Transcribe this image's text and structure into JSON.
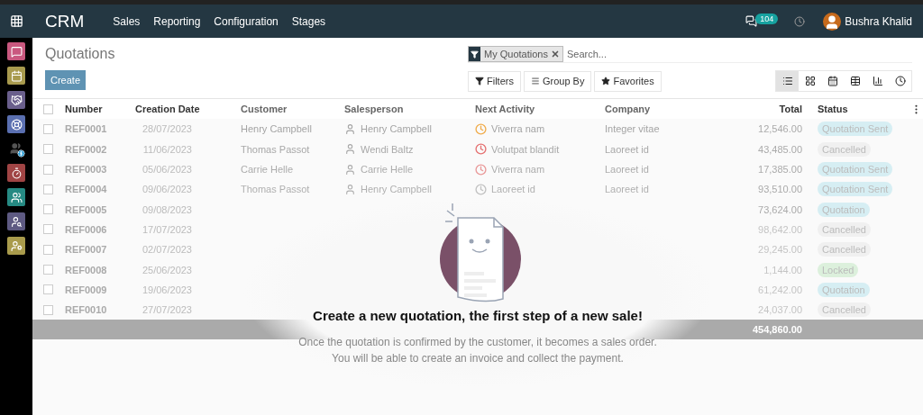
{
  "navbar": {
    "app_name": "CRM",
    "menus": [
      "Sales",
      "Reporting",
      "Configuration",
      "Stages"
    ],
    "message_count": "104",
    "user_name": "Bushra Khalid"
  },
  "sidebar": {
    "items": [
      {
        "kind": "chat",
        "color": "#c9587f"
      },
      {
        "kind": "calendar",
        "color": "#a89a4e"
      },
      {
        "kind": "handshake",
        "color": "#6a5f8c"
      },
      {
        "kind": "lifebuoy",
        "color": "#5a6fb0"
      },
      {
        "kind": "payroll",
        "color": "#000000"
      },
      {
        "kind": "timer",
        "color": "#a04444"
      },
      {
        "kind": "team",
        "color": "#268a83"
      },
      {
        "kind": "search",
        "color": "#5e5a82"
      },
      {
        "kind": "settings",
        "color": "#a99b4c"
      }
    ]
  },
  "control_panel": {
    "title": "Quotations",
    "create_button": "Create",
    "facet": "My Quotations",
    "search_placeholder": "Search...",
    "buttons": [
      "Filters",
      "Group By",
      "Favorites"
    ],
    "views": [
      {
        "kind": "list",
        "selected": true
      },
      {
        "kind": "kanban",
        "selected": false
      },
      {
        "kind": "calendar",
        "selected": false
      },
      {
        "kind": "pivot",
        "selected": false
      },
      {
        "kind": "graph",
        "selected": false
      },
      {
        "kind": "activity",
        "selected": false
      }
    ]
  },
  "table": {
    "select_all": {
      "checked": false
    },
    "columns": [
      "Number",
      "Creation Date",
      "Customer",
      "Salesperson",
      "Next Activity",
      "Company",
      "Total",
      "Status"
    ],
    "rows": [
      {
        "checked": false,
        "number": "REF0001",
        "date": "28/07/2023",
        "customer": "Henry Campbell",
        "salesperson": "Henry Campbell",
        "activity": {
          "text": "Viverra nam",
          "color": "#f0ad4e"
        },
        "company": "Integer vitae",
        "total": "12,546.00",
        "status": {
          "text": "Quotation Sent",
          "color": "#d6eef3"
        }
      },
      {
        "checked": false,
        "number": "REF0002",
        "date": "11/06/2023",
        "customer": "Thomas Passot",
        "salesperson": "Wendi Baltz",
        "activity": {
          "text": "Volutpat blandit",
          "color": "#e57373"
        },
        "company": "Laoreet id",
        "total": "43,485.00",
        "status": {
          "text": "Cancelled",
          "color": "#f0f0f0"
        }
      },
      {
        "checked": false,
        "number": "REF0003",
        "date": "05/06/2023",
        "customer": "Carrie Helle",
        "salesperson": "Carrie Helle",
        "activity": {
          "text": "Viverra nam",
          "color": "#e99a9a"
        },
        "company": "Laoreet id",
        "total": "17,385.00",
        "status": {
          "text": "Quotation Sent",
          "color": "#d6eef3"
        }
      },
      {
        "checked": false,
        "number": "REF0004",
        "date": "09/06/2023",
        "customer": "Thomas Passot",
        "salesperson": "Henry Campbell",
        "activity": {
          "text": "Laoreet id",
          "color": "#c2c2c2"
        },
        "company": "Laoreet id",
        "total": "93,510.00",
        "status": {
          "text": "Quotation Sent",
          "color": "#d6eef3"
        }
      },
      {
        "checked": false,
        "number": "REF0005",
        "date": "09/08/2023",
        "total": "73,624.00",
        "status": {
          "text": "Quotation",
          "color": "#d6eef3"
        }
      },
      {
        "checked": false,
        "number": "REF0006",
        "date": "17/07/2023",
        "total": "98,642.00",
        "status": {
          "text": "Cancelled",
          "color": "#f0f0f0"
        }
      },
      {
        "checked": false,
        "number": "REF0007",
        "date": "02/07/2023",
        "total": "29,245.00",
        "status": {
          "text": "Cancelled",
          "color": "#f0f0f0"
        }
      },
      {
        "checked": false,
        "number": "REF0008",
        "date": "25/06/2023",
        "total": "1,144.00",
        "status": {
          "text": "Locked",
          "color": "#dcf0dc"
        }
      },
      {
        "checked": false,
        "number": "REF0009",
        "date": "19/06/2023",
        "total": "61,242.00",
        "status": {
          "text": "Quotation",
          "color": "#d6eef3"
        }
      },
      {
        "checked": false,
        "number": "REF0010",
        "date": "27/07/2023",
        "total": "24,037.00",
        "status": {
          "text": "Cancelled",
          "color": "#f0f0f0"
        }
      }
    ],
    "grand_total": "454,860.00"
  },
  "empty_state": {
    "title": "Create a new quotation, the first step of a new sale!",
    "lines": [
      "Once the quotation is confirmed by the customer, it becomes a sales order.",
      "You will be able to create an invoice and collect the payment."
    ]
  }
}
